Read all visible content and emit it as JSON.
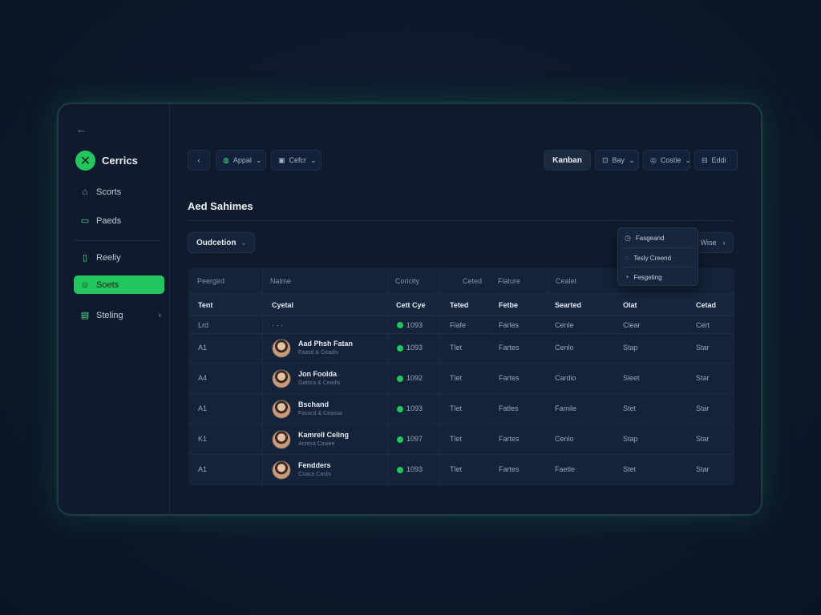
{
  "sidebar": {
    "back_icon": "arrow-left-icon",
    "brand": {
      "name": "Cerrics",
      "logo_icon": "x-mark-icon",
      "color": "#22c55e"
    },
    "items": [
      {
        "label": "Scorts",
        "icon": "home-icon"
      },
      {
        "label": "Paeds",
        "icon": "card-icon"
      },
      {
        "label": "Reeliy",
        "icon": "bookmark-icon"
      },
      {
        "label": "Soets",
        "icon": "users-icon",
        "active": true
      },
      {
        "label": "Steling",
        "icon": "inbox-icon",
        "has_chevron": true
      }
    ]
  },
  "toolbar": {
    "back_label": "‹",
    "appal_label": "Appal",
    "color_label": "Cefcr",
    "kanban_label": "Kanban",
    "bay_label": "Bay",
    "costie_label": "Costie",
    "edit_label": "Eddi"
  },
  "page": {
    "title": "Aed Sahimes",
    "filter_label": "Oudcetion",
    "view_label": "Wise"
  },
  "dropdown": {
    "items": [
      {
        "label": "Fasgeand",
        "icon": "clock-icon"
      },
      {
        "label": "Tesly Creend",
        "icon": "tag-icon"
      },
      {
        "label": "Fesgeting",
        "icon": "chart-icon"
      }
    ]
  },
  "table": {
    "header_top": [
      "Peergird",
      "Nalme",
      "Coricity",
      "Ceted",
      "Fiature",
      "Cealet"
    ],
    "header_main": [
      "Tent",
      "Cyetal",
      "Cett Cye",
      "Teted",
      "Fetbe",
      "Searted",
      "Olat",
      "Cetad"
    ],
    "first_row": [
      "Lrd",
      "· · ·",
      "1093",
      "Fiafe",
      "Farles",
      "Cenle",
      "Clear",
      "Cert"
    ],
    "rows": [
      {
        "id": "A1",
        "name": "Aad Phsh Fatan",
        "sub": "Faasd & Ceadis",
        "num": "1093",
        "c4": "Tlet",
        "c5": "Fartes",
        "c6": "Cenlo",
        "c7": "Stap",
        "c8": "Star"
      },
      {
        "id": "A4",
        "name": "Jon Foolda",
        "sub": "Gatsca & Ceadis",
        "num": "1092",
        "c4": "Tlet",
        "c5": "Fartes",
        "c6": "Cardio",
        "c7": "Sleet",
        "c8": "Star"
      },
      {
        "id": "A1",
        "name": "Bschand",
        "sub": "Fasscd & Ceassa",
        "num": "1093",
        "c4": "Tlet",
        "c5": "Fatles",
        "c6": "Famile",
        "c7": "Stet",
        "c8": "Star"
      },
      {
        "id": "K1",
        "name": "Kamrell Celing",
        "sub": "Arzeca Casiee",
        "num": "1097",
        "c4": "Tlet",
        "c5": "Fartes",
        "c6": "Cenlo",
        "c7": "Stap",
        "c8": "Star"
      },
      {
        "id": "A1",
        "name": "Fendders",
        "sub": "Coaca Caslis",
        "num": "1093",
        "c4": "Tlet",
        "c5": "Fartes",
        "c6": "Faetle",
        "c7": "Stet",
        "c8": "Star"
      }
    ]
  }
}
